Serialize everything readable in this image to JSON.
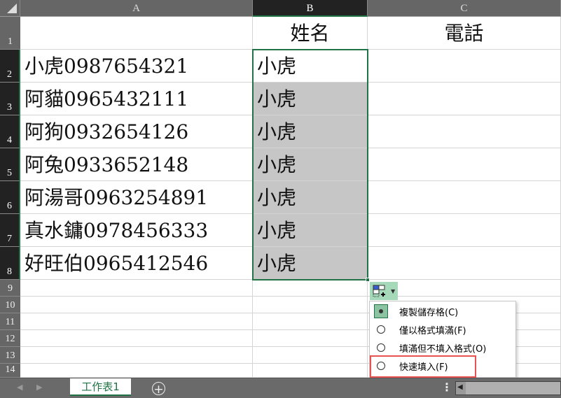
{
  "columns": [
    "A",
    "B",
    "C"
  ],
  "rows": [
    "1",
    "2",
    "3",
    "4",
    "5",
    "6",
    "7",
    "8",
    "9",
    "10",
    "11",
    "12",
    "13",
    "14"
  ],
  "cells": {
    "B1": "姓名",
    "C1": "電話",
    "A": [
      "小虎0987654321",
      "阿貓0965432111",
      "阿狗0932654126",
      "阿兔0933652148",
      "阿湯哥0963254891",
      "真水鏞0978456333",
      "好旺伯0965412546"
    ],
    "B": [
      "小虎",
      "小虎",
      "小虎",
      "小虎",
      "小虎",
      "小虎",
      "小虎"
    ]
  },
  "autofill_menu": {
    "items": [
      "複製儲存格(C)",
      "僅以格式填滿(F)",
      "填滿但不填入格式(O)",
      "快速填入(F)"
    ],
    "selected": 0,
    "highlighted": 3
  },
  "sheet_tab": "工作表1",
  "colors": {
    "accent": "#217346",
    "highlight": "#e8514f"
  }
}
